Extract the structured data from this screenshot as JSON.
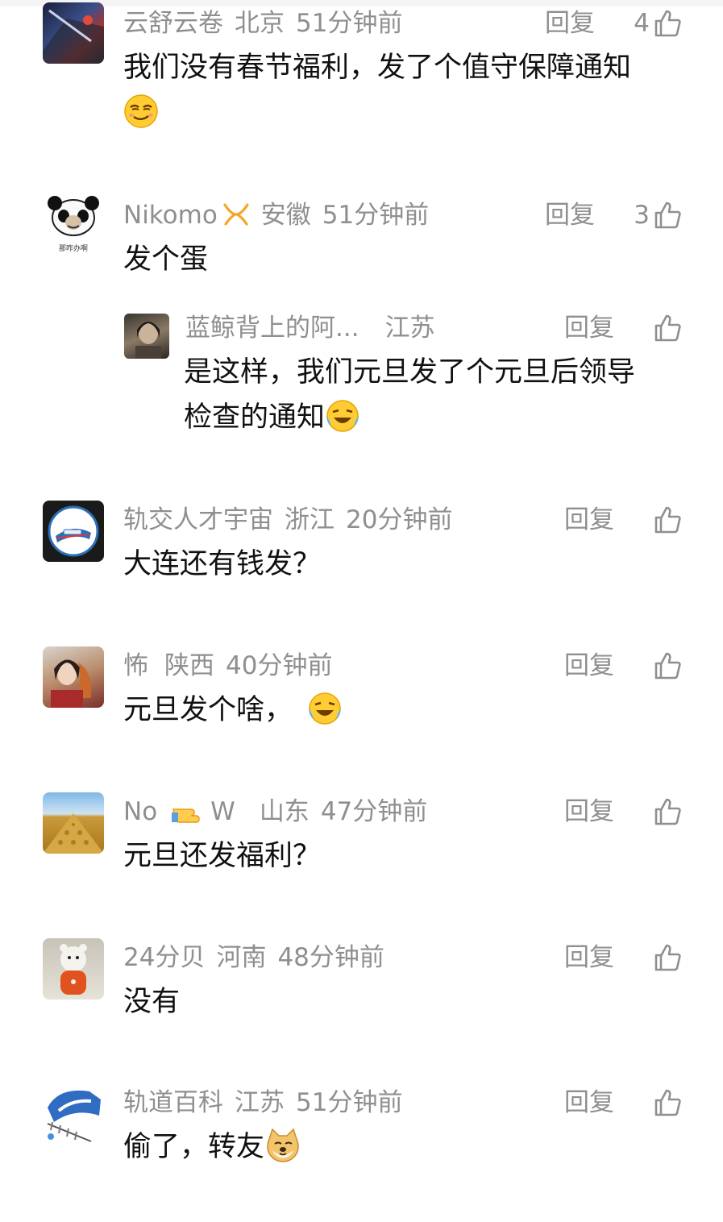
{
  "comments": [
    {
      "user": "云舒云卷",
      "location": "北京",
      "time": "51分钟前",
      "reply_label": "回复",
      "likes": "4",
      "text": "我们没有春节福利，发了个值守保障通知",
      "emoji": "smirk-face-emoji"
    },
    {
      "user": "Nikomo",
      "location": "安徽",
      "time": "51分钟前",
      "reply_label": "回复",
      "likes": "3",
      "text": "发个蛋",
      "avatar_text": "那咋办啊",
      "replies": [
        {
          "user": "蓝鲸背上的阿...",
          "location": "江苏",
          "time": "",
          "reply_label": "回复",
          "likes": "",
          "text_line1": "是这样，我们元旦发了个元旦后领导",
          "text_line2": "检查的通知",
          "emoji": "crying-laughing-emoji"
        }
      ]
    },
    {
      "user": "轨交人才宇宙",
      "location": "浙江",
      "time": "20分钟前",
      "reply_label": "回复",
      "likes": "",
      "text": "大连还有钱发？"
    },
    {
      "user": "怖",
      "location": "陕西",
      "time": "40分钟前",
      "reply_label": "回复",
      "likes": "",
      "text": "元旦发个啥，",
      "emoji": "crying-laughing-emoji"
    },
    {
      "user_part1": "No",
      "user_part2": "W",
      "location": "山东",
      "time": "47分钟前",
      "reply_label": "回复",
      "likes": "",
      "text": "元旦还发福利？",
      "name_emoji": "pointing-hand-emoji"
    },
    {
      "user": "24分贝",
      "location": "河南",
      "time": "48分钟前",
      "reply_label": "回复",
      "likes": "",
      "text": "没有"
    },
    {
      "user": "轨道百科",
      "location": "江苏",
      "time": "51分钟前",
      "reply_label": "回复",
      "likes": "",
      "text": "偷了，转友",
      "emoji": "doge-emoji"
    }
  ],
  "colors": {
    "meta_gray": "#8f8f8f",
    "text": "#111111",
    "badge_orange": "#f5a623"
  },
  "icons": {
    "like": "thumbs-up-outline-icon"
  }
}
